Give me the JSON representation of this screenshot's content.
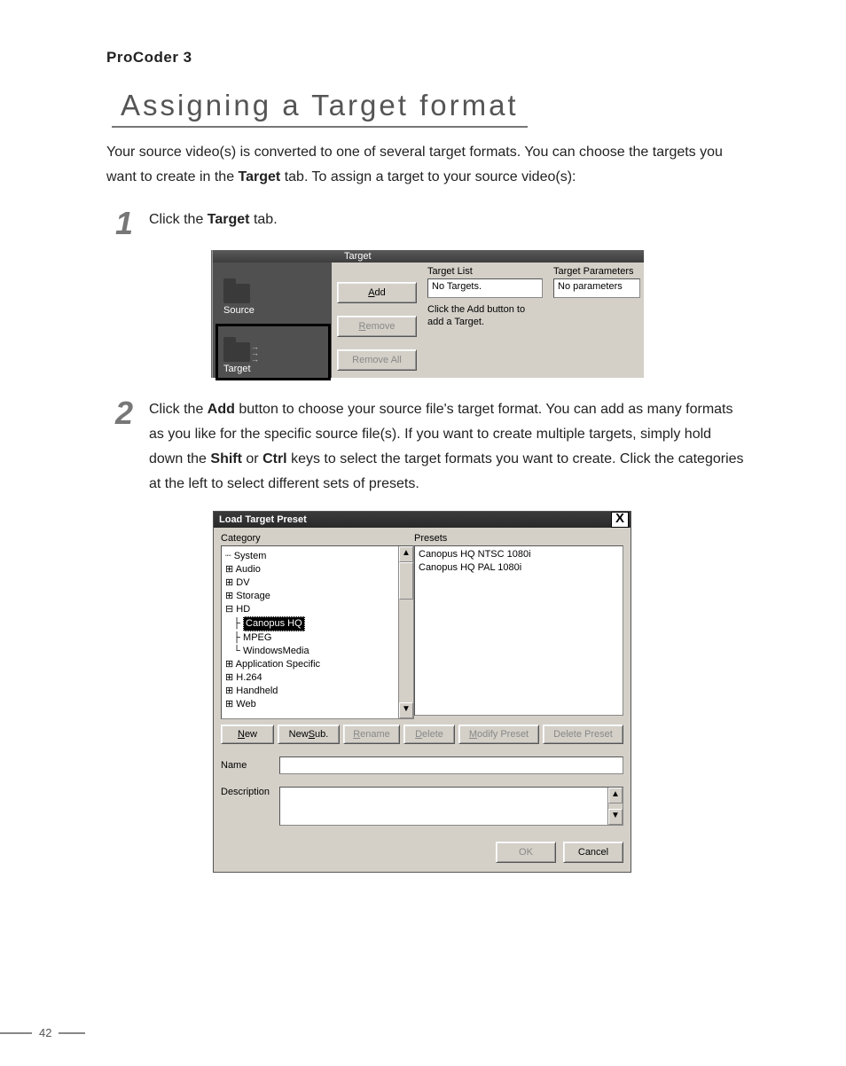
{
  "doc": {
    "product": "ProCoder 3",
    "section": "Assigning a Target format",
    "intro_a": "Your source video(s) is converted to one of several target formats. You can choose the targets you want to create in the ",
    "intro_bold": "Target",
    "intro_b": " tab. To assign a target to your source video(s):",
    "page_number": "42"
  },
  "steps": {
    "s1_num": "1",
    "s1_a": "Click the ",
    "s1_bold": "Target",
    "s1_b": " tab.",
    "s2_num": "2",
    "s2_a": "Click the ",
    "s2_bold1": "Add",
    "s2_b": " button to choose your source file's target format. You can add as many formats as you like for the specific source file(s). If you want to create multiple targets, simply hold down the ",
    "s2_bold2": "Shift",
    "s2_c": " or ",
    "s2_bold3": "Ctrl",
    "s2_d": " keys to select the target formats you want to create. Click the categories at the left to select different sets of presets."
  },
  "shot1": {
    "tab": "Target",
    "nav_source": "Source",
    "nav_target": "Target",
    "btn_add_u": "A",
    "btn_add": "dd",
    "btn_remove_u": "R",
    "btn_remove": "emove",
    "btn_removeall": "Remove All",
    "hdr_list": "Target List",
    "list_value": "No Targets.",
    "hint": "Click the Add button to add a Target.",
    "hdr_params": "Target Parameters",
    "params_value": "No parameters"
  },
  "shot2": {
    "title": "Load  Target Preset",
    "lbl_category": "Category",
    "lbl_presets": "Presets",
    "tree": {
      "system": "System",
      "audio": "Audio",
      "dv": "DV",
      "storage": "Storage",
      "hd": "HD",
      "canopus": "Canopus HQ",
      "mpeg": "MPEG",
      "wm": "WindowsMedia",
      "app": "Application Specific",
      "h264": "H.264",
      "hand": "Handheld",
      "web": "Web"
    },
    "presets": {
      "p1": "Canopus HQ NTSC 1080i",
      "p2": "Canopus HQ PAL 1080i"
    },
    "btns": {
      "new_u": "N",
      "new": "ew",
      "newsub_a": "New ",
      "newsub_u": "S",
      "newsub_b": "ub.",
      "rename_u": "R",
      "rename": "ename",
      "delete_u": "D",
      "delete": "elete",
      "modify_u": "M",
      "modify": "odify Preset",
      "delpreset": "Delete Preset"
    },
    "lbl_name": "Name",
    "lbl_desc": "Description",
    "ok": "OK",
    "cancel": "Cancel"
  }
}
